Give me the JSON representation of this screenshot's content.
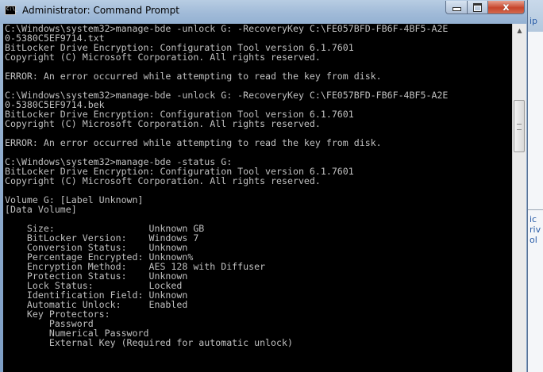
{
  "window": {
    "title": "Administrator: Command Prompt",
    "icon_text": "C:\\_",
    "close_glyph": "x"
  },
  "console": {
    "lines": [
      "C:\\Windows\\system32>manage-bde -unlock G: -RecoveryKey C:\\FE057BFD-FB6F-4BF5-A2E",
      "0-5380C5EF9714.txt",
      "BitLocker Drive Encryption: Configuration Tool version 6.1.7601",
      "Copyright (C) Microsoft Corporation. All rights reserved.",
      "",
      "ERROR: An error occurred while attempting to read the key from disk.",
      "",
      "C:\\Windows\\system32>manage-bde -unlock G: -RecoveryKey C:\\FE057BFD-FB6F-4BF5-A2E",
      "0-5380C5EF9714.bek",
      "BitLocker Drive Encryption: Configuration Tool version 6.1.7601",
      "Copyright (C) Microsoft Corporation. All rights reserved.",
      "",
      "ERROR: An error occurred while attempting to read the key from disk.",
      "",
      "C:\\Windows\\system32>manage-bde -status G:",
      "BitLocker Drive Encryption: Configuration Tool version 6.1.7601",
      "Copyright (C) Microsoft Corporation. All rights reserved.",
      "",
      "Volume G: [Label Unknown]",
      "[Data Volume]",
      "",
      "    Size:                 Unknown GB",
      "    BitLocker Version:    Windows 7",
      "    Conversion Status:    Unknown",
      "    Percentage Encrypted: Unknown%",
      "    Encryption Method:    AES 128 with Diffuser",
      "    Protection Status:    Unknown",
      "    Lock Status:          Locked",
      "    Identification Field: Unknown",
      "    Automatic Unlock:     Enabled",
      "    Key Protectors:",
      "        Password",
      "        Numerical Password",
      "        External Key (Required for automatic unlock)"
    ]
  },
  "background_window": {
    "fragments": [
      "ip",
      "ic",
      "riv",
      "ol"
    ]
  },
  "colors": {
    "console_bg": "#000000",
    "console_text": "#c0c0c0",
    "close_button": "#c7452b"
  }
}
